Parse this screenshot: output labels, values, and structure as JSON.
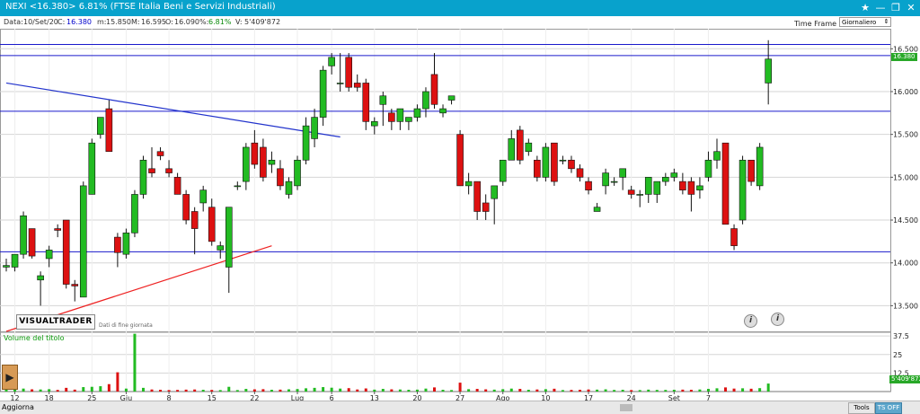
{
  "window": {
    "title": "NEXI <16.380> 6.81%  (FTSE Italia Beni e Servizi Industriali)",
    "controls": [
      "★",
      "—",
      "❐",
      "✕"
    ]
  },
  "info": {
    "data_label": "Data:",
    "data_value": "10/Set/20",
    "c_label": "C:",
    "c_value": "16.380",
    "m_label": "m:",
    "m_value": "15.850",
    "M_label": "M:",
    "M_value": "16.595",
    "o_label": "O:",
    "o_value": "16.090",
    "pct_label": "%:",
    "pct_value": "6.81%",
    "v_label": "V:",
    "v_value": "5'409'872"
  },
  "timeframe": {
    "label": "Time Frame",
    "value": "Giornaliero",
    "arrow": "⇕"
  },
  "price_tag": "16.380",
  "volume_tag": "5'409'872",
  "logo": "VISUALTRADER",
  "logo_sub": "Dati di fine giornata",
  "volume_label": "Volume del titolo",
  "info_icons": [
    "i",
    "i"
  ],
  "side_handle": "▶",
  "bottom": {
    "aggiorna": "Aggiorna",
    "tools": "Tools",
    "ts_off": "TS OFF"
  },
  "colors": {
    "up": "#22bb22",
    "down": "#dd1111",
    "hline": "#1a1acc",
    "trend_blue": "#2233cc",
    "trend_red": "#ee2222",
    "title_bg": "#08a2cc",
    "grid": "#d6d6d6"
  },
  "chart_data": {
    "type": "candlestick",
    "y_ticks": [
      "16.500",
      "16.000",
      "15.500",
      "15.000",
      "14.500",
      "14.000",
      "13.500"
    ],
    "ylim": [
      13.2,
      16.65
    ],
    "volume_ticks": [
      "37.5",
      "25",
      "12.5"
    ],
    "volume_ylim": [
      0,
      40
    ],
    "x_ticks": [
      "12",
      "18",
      "25",
      "Giu",
      "8",
      "15",
      "22",
      "Lug",
      "6",
      "13",
      "20",
      "27",
      "Ago",
      "10",
      "17",
      "24",
      "Set",
      "7"
    ],
    "x_tick_slots": [
      1,
      5,
      10,
      14,
      19,
      24,
      29,
      34,
      38,
      43,
      48,
      53,
      58,
      63,
      68,
      73,
      78,
      82
    ],
    "horizontal_levels": [
      16.55,
      16.42,
      15.77,
      14.13
    ],
    "trend_lines": [
      {
        "color": "blue",
        "from": [
          0,
          16.1
        ],
        "to": [
          39,
          15.47
        ]
      },
      {
        "color": "red",
        "from": [
          0,
          13.2
        ],
        "to": [
          31,
          14.2
        ]
      }
    ],
    "candles": [
      {
        "o": 13.95,
        "h": 14.05,
        "l": 13.9,
        "c": 13.97,
        "v": 1.2
      },
      {
        "o": 13.95,
        "h": 14.1,
        "l": 13.9,
        "c": 14.1,
        "v": 1.3
      },
      {
        "o": 14.1,
        "h": 14.6,
        "l": 14.05,
        "c": 14.55,
        "v": 2.0
      },
      {
        "o": 14.4,
        "h": 14.4,
        "l": 14.05,
        "c": 14.08,
        "v": 1.5
      },
      {
        "o": 13.8,
        "h": 13.9,
        "l": 13.5,
        "c": 13.85,
        "v": 1.4
      },
      {
        "o": 14.05,
        "h": 14.2,
        "l": 13.95,
        "c": 14.15,
        "v": 1.6
      },
      {
        "o": 14.4,
        "h": 14.45,
        "l": 14.3,
        "c": 14.38,
        "v": 1.1
      },
      {
        "o": 14.5,
        "h": 14.5,
        "l": 13.7,
        "c": 13.75,
        "v": 2.5
      },
      {
        "o": 13.75,
        "h": 13.8,
        "l": 13.55,
        "c": 13.73,
        "v": 1.3
      },
      {
        "o": 13.6,
        "h": 14.95,
        "l": 13.6,
        "c": 14.9,
        "v": 3.0
      },
      {
        "o": 14.8,
        "h": 15.45,
        "l": 14.8,
        "c": 15.4,
        "v": 3.2
      },
      {
        "o": 15.5,
        "h": 15.7,
        "l": 15.45,
        "c": 15.7,
        "v": 3.6
      },
      {
        "o": 15.8,
        "h": 15.9,
        "l": 15.3,
        "c": 15.3,
        "v": 5.0
      },
      {
        "o": 14.3,
        "h": 14.35,
        "l": 13.95,
        "c": 14.12,
        "v": 13.0
      },
      {
        "o": 14.1,
        "h": 14.4,
        "l": 14.05,
        "c": 14.35,
        "v": 2.0
      },
      {
        "o": 14.35,
        "h": 14.85,
        "l": 14.3,
        "c": 14.8,
        "v": 39.0
      },
      {
        "o": 14.8,
        "h": 15.25,
        "l": 14.75,
        "c": 15.2,
        "v": 2.5
      },
      {
        "o": 15.1,
        "h": 15.35,
        "l": 15.0,
        "c": 15.05,
        "v": 1.4
      },
      {
        "o": 15.3,
        "h": 15.35,
        "l": 15.2,
        "c": 15.25,
        "v": 1.2
      },
      {
        "o": 15.1,
        "h": 15.2,
        "l": 15.0,
        "c": 15.05,
        "v": 1.0
      },
      {
        "o": 15.0,
        "h": 15.05,
        "l": 14.8,
        "c": 14.8,
        "v": 1.1
      },
      {
        "o": 14.8,
        "h": 14.85,
        "l": 14.45,
        "c": 14.5,
        "v": 1.3
      },
      {
        "o": 14.6,
        "h": 14.65,
        "l": 14.1,
        "c": 14.4,
        "v": 1.4
      },
      {
        "o": 14.7,
        "h": 14.9,
        "l": 14.6,
        "c": 14.85,
        "v": 1.2
      },
      {
        "o": 14.65,
        "h": 14.75,
        "l": 14.2,
        "c": 14.25,
        "v": 1.1
      },
      {
        "o": 14.15,
        "h": 14.25,
        "l": 14.05,
        "c": 14.2,
        "v": 1.0
      },
      {
        "o": 13.95,
        "h": 14.65,
        "l": 13.65,
        "c": 14.65,
        "v": 3.2
      },
      {
        "o": 14.9,
        "h": 14.95,
        "l": 14.85,
        "c": 14.9,
        "v": 1.0
      },
      {
        "o": 14.95,
        "h": 15.4,
        "l": 14.85,
        "c": 15.35,
        "v": 1.8
      },
      {
        "o": 15.4,
        "h": 15.55,
        "l": 15.1,
        "c": 15.15,
        "v": 1.5
      },
      {
        "o": 15.35,
        "h": 15.45,
        "l": 14.95,
        "c": 15.0,
        "v": 1.6
      },
      {
        "o": 15.15,
        "h": 15.3,
        "l": 15.05,
        "c": 15.2,
        "v": 1.2
      },
      {
        "o": 15.1,
        "h": 15.2,
        "l": 14.85,
        "c": 14.9,
        "v": 1.3
      },
      {
        "o": 14.8,
        "h": 15.0,
        "l": 14.75,
        "c": 14.95,
        "v": 1.5
      },
      {
        "o": 14.9,
        "h": 15.25,
        "l": 14.85,
        "c": 15.2,
        "v": 1.7
      },
      {
        "o": 15.2,
        "h": 15.7,
        "l": 15.15,
        "c": 15.6,
        "v": 2.2
      },
      {
        "o": 15.45,
        "h": 15.8,
        "l": 15.35,
        "c": 15.7,
        "v": 2.5
      },
      {
        "o": 15.7,
        "h": 16.3,
        "l": 15.6,
        "c": 16.25,
        "v": 3.0
      },
      {
        "o": 16.3,
        "h": 16.45,
        "l": 16.2,
        "c": 16.4,
        "v": 2.6
      },
      {
        "o": 16.1,
        "h": 16.45,
        "l": 16.0,
        "c": 16.1,
        "v": 2.0
      },
      {
        "o": 16.4,
        "h": 16.45,
        "l": 16.0,
        "c": 16.05,
        "v": 2.3
      },
      {
        "o": 16.1,
        "h": 16.2,
        "l": 16.0,
        "c": 16.05,
        "v": 1.4
      },
      {
        "o": 16.1,
        "h": 16.15,
        "l": 15.55,
        "c": 15.65,
        "v": 2.1
      },
      {
        "o": 15.6,
        "h": 15.7,
        "l": 15.5,
        "c": 15.65,
        "v": 1.3
      },
      {
        "o": 15.85,
        "h": 16.0,
        "l": 15.6,
        "c": 15.95,
        "v": 1.8
      },
      {
        "o": 15.75,
        "h": 15.8,
        "l": 15.55,
        "c": 15.65,
        "v": 1.5
      },
      {
        "o": 15.65,
        "h": 15.8,
        "l": 15.55,
        "c": 15.8,
        "v": 1.4
      },
      {
        "o": 15.65,
        "h": 15.7,
        "l": 15.55,
        "c": 15.7,
        "v": 1.2
      },
      {
        "o": 15.7,
        "h": 15.85,
        "l": 15.65,
        "c": 15.8,
        "v": 1.3
      },
      {
        "o": 15.8,
        "h": 16.05,
        "l": 15.7,
        "c": 16.0,
        "v": 2.0
      },
      {
        "o": 16.2,
        "h": 16.45,
        "l": 15.8,
        "c": 15.85,
        "v": 2.8
      },
      {
        "o": 15.75,
        "h": 15.85,
        "l": 15.7,
        "c": 15.8,
        "v": 1.2
      },
      {
        "o": 15.9,
        "h": 15.95,
        "l": 15.85,
        "c": 15.95,
        "v": 1.0
      },
      {
        "o": 15.5,
        "h": 15.55,
        "l": 14.9,
        "c": 14.9,
        "v": 6.0
      },
      {
        "o": 14.9,
        "h": 15.05,
        "l": 14.8,
        "c": 14.95,
        "v": 1.6
      },
      {
        "o": 14.95,
        "h": 14.95,
        "l": 14.5,
        "c": 14.6,
        "v": 1.8
      },
      {
        "o": 14.7,
        "h": 14.8,
        "l": 14.5,
        "c": 14.6,
        "v": 1.5
      },
      {
        "o": 14.75,
        "h": 14.9,
        "l": 14.45,
        "c": 14.9,
        "v": 1.3
      },
      {
        "o": 14.95,
        "h": 15.2,
        "l": 14.9,
        "c": 15.2,
        "v": 1.6
      },
      {
        "o": 15.2,
        "h": 15.55,
        "l": 15.2,
        "c": 15.45,
        "v": 2.0
      },
      {
        "o": 15.55,
        "h": 15.6,
        "l": 15.15,
        "c": 15.2,
        "v": 1.8
      },
      {
        "o": 15.3,
        "h": 15.45,
        "l": 15.25,
        "c": 15.4,
        "v": 1.2
      },
      {
        "o": 15.2,
        "h": 15.25,
        "l": 14.95,
        "c": 15.0,
        "v": 1.4
      },
      {
        "o": 15.0,
        "h": 15.4,
        "l": 14.95,
        "c": 15.35,
        "v": 1.6
      },
      {
        "o": 15.4,
        "h": 15.4,
        "l": 14.9,
        "c": 14.95,
        "v": 1.9
      },
      {
        "o": 15.2,
        "h": 15.25,
        "l": 15.15,
        "c": 15.2,
        "v": 1.0
      },
      {
        "o": 15.2,
        "h": 15.25,
        "l": 15.05,
        "c": 15.1,
        "v": 1.1
      },
      {
        "o": 15.1,
        "h": 15.15,
        "l": 14.95,
        "c": 15.0,
        "v": 1.2
      },
      {
        "o": 14.95,
        "h": 15.0,
        "l": 14.8,
        "c": 14.85,
        "v": 1.4
      },
      {
        "o": 14.6,
        "h": 14.7,
        "l": 14.6,
        "c": 14.65,
        "v": 1.3
      },
      {
        "o": 14.9,
        "h": 15.1,
        "l": 14.8,
        "c": 15.05,
        "v": 1.5
      },
      {
        "o": 14.95,
        "h": 15.0,
        "l": 14.9,
        "c": 14.95,
        "v": 1.1
      },
      {
        "o": 15.0,
        "h": 15.1,
        "l": 14.85,
        "c": 15.1,
        "v": 1.2
      },
      {
        "o": 14.85,
        "h": 14.9,
        "l": 14.75,
        "c": 14.8,
        "v": 1.0
      },
      {
        "o": 14.8,
        "h": 14.85,
        "l": 14.65,
        "c": 14.8,
        "v": 1.0
      },
      {
        "o": 14.8,
        "h": 15.0,
        "l": 14.7,
        "c": 15.0,
        "v": 1.3
      },
      {
        "o": 14.8,
        "h": 14.95,
        "l": 14.7,
        "c": 14.95,
        "v": 1.1
      },
      {
        "o": 14.95,
        "h": 15.05,
        "l": 14.9,
        "c": 15.0,
        "v": 1.1
      },
      {
        "o": 15.0,
        "h": 15.1,
        "l": 14.95,
        "c": 15.05,
        "v": 1.2
      },
      {
        "o": 14.95,
        "h": 15.05,
        "l": 14.8,
        "c": 14.85,
        "v": 1.3
      },
      {
        "o": 14.95,
        "h": 15.0,
        "l": 14.6,
        "c": 14.8,
        "v": 1.2
      },
      {
        "o": 14.85,
        "h": 15.0,
        "l": 14.75,
        "c": 14.9,
        "v": 1.4
      },
      {
        "o": 15.0,
        "h": 15.3,
        "l": 14.95,
        "c": 15.2,
        "v": 1.8
      },
      {
        "o": 15.2,
        "h": 15.45,
        "l": 15.1,
        "c": 15.3,
        "v": 2.2
      },
      {
        "o": 15.4,
        "h": 15.4,
        "l": 14.45,
        "c": 14.45,
        "v": 2.8
      },
      {
        "o": 14.4,
        "h": 14.45,
        "l": 14.15,
        "c": 14.2,
        "v": 2.0
      },
      {
        "o": 14.5,
        "h": 15.25,
        "l": 14.45,
        "c": 15.2,
        "v": 2.2
      },
      {
        "o": 15.2,
        "h": 15.2,
        "l": 14.9,
        "c": 14.95,
        "v": 1.9
      },
      {
        "o": 14.9,
        "h": 15.4,
        "l": 14.85,
        "c": 15.35,
        "v": 2.3
      },
      {
        "o": 16.1,
        "h": 16.6,
        "l": 15.85,
        "c": 16.38,
        "v": 5.4
      }
    ]
  }
}
